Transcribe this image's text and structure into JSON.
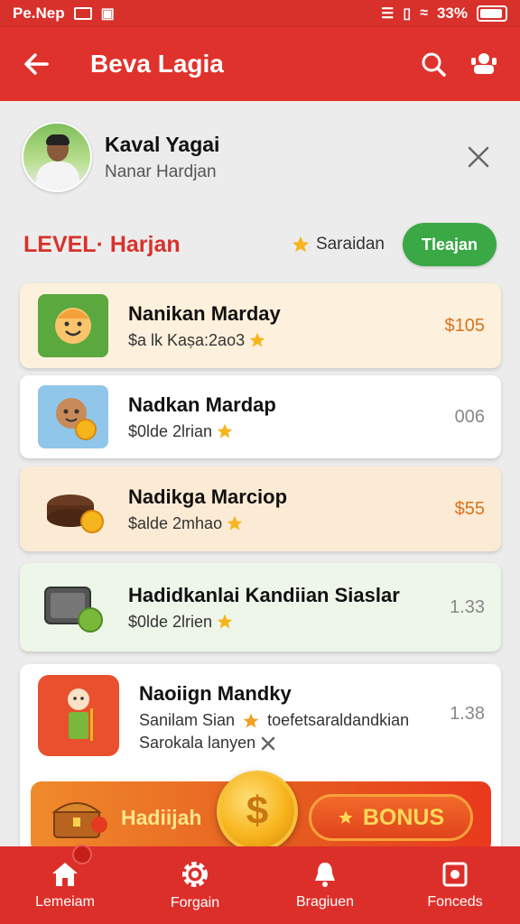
{
  "status_bar": {
    "left_text": "Pe.Nep",
    "battery_text": "33%"
  },
  "app_bar": {
    "title": "Beva Lagia"
  },
  "profile": {
    "name": "Kaval Yagai",
    "subtitle": "Nanar Hardjan"
  },
  "level": {
    "label": "LEVEL· Harjan",
    "status": "Saraidan",
    "button": "Tleajan"
  },
  "cards": [
    {
      "title": "Nanikan Marday",
      "subtitle": "$a lk Kaṣa:2ao3",
      "value": "$105"
    },
    {
      "title": "Nadkan Mardap",
      "subtitle": "$0lde 2lrian",
      "value": "006"
    },
    {
      "title": "Nadikga Marciop",
      "subtitle": "$alde 2mhao",
      "value": "$55"
    },
    {
      "title": "Hadidkanlai Kandiian Siaslar",
      "subtitle": "$0lde 2lrien",
      "value": "1.33"
    },
    {
      "title": "Naoiign Mandky",
      "subtitle": "Sanilam Sian",
      "subtitle_extra": "toefetsaraldandkian",
      "subtitle2": "Sarokala lanyen",
      "value": "1.38"
    }
  ],
  "banner": {
    "label": "Hadiijah",
    "button": "BONUS"
  },
  "bottom_nav": [
    {
      "label": "Lemeiam",
      "icon": "home-icon"
    },
    {
      "label": "Forgain",
      "icon": "gear-icon"
    },
    {
      "label": "Bragiuen",
      "icon": "bell-icon"
    },
    {
      "label": "Fonceds",
      "icon": "wallet-icon"
    }
  ],
  "colors": {
    "primary": "#e0322c",
    "green": "#3aa845",
    "orange": "#d9731e"
  }
}
